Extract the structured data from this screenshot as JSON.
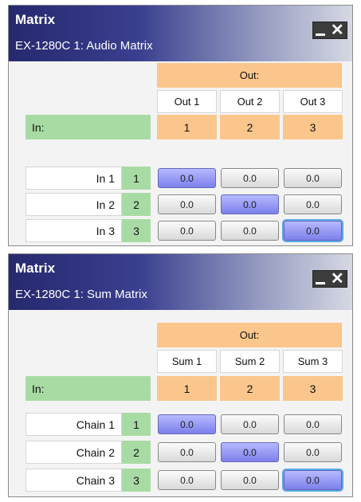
{
  "panels": [
    {
      "title": "Matrix",
      "subtitle": "EX-1280C 1: Audio Matrix",
      "out_label": "Out:",
      "in_label": "In:",
      "columns": [
        {
          "label": "Out 1",
          "num": "1"
        },
        {
          "label": "Out 2",
          "num": "2"
        },
        {
          "label": "Out 3",
          "num": "3"
        }
      ],
      "rows": [
        {
          "label": "In 1",
          "num": "1",
          "cells": [
            {
              "value": "0.0",
              "on": true
            },
            {
              "value": "0.0",
              "on": false
            },
            {
              "value": "0.0",
              "on": false
            }
          ]
        },
        {
          "label": "In 2",
          "num": "2",
          "cells": [
            {
              "value": "0.0",
              "on": false
            },
            {
              "value": "0.0",
              "on": true
            },
            {
              "value": "0.0",
              "on": false
            }
          ]
        },
        {
          "label": "In 3",
          "num": "3",
          "cells": [
            {
              "value": "0.0",
              "on": false
            },
            {
              "value": "0.0",
              "on": false
            },
            {
              "value": "0.0",
              "on": true,
              "focused": true
            }
          ]
        }
      ]
    },
    {
      "title": "Matrix",
      "subtitle": "EX-1280C 1: Sum Matrix",
      "out_label": "Out:",
      "in_label": "In:",
      "columns": [
        {
          "label": "Sum 1",
          "num": "1"
        },
        {
          "label": "Sum 2",
          "num": "2"
        },
        {
          "label": "Sum 3",
          "num": "3"
        }
      ],
      "rows": [
        {
          "label": "Chain 1",
          "num": "1",
          "cells": [
            {
              "value": "0.0",
              "on": true
            },
            {
              "value": "0.0",
              "on": false
            },
            {
              "value": "0.0",
              "on": false
            }
          ]
        },
        {
          "label": "Chain 2",
          "num": "2",
          "cells": [
            {
              "value": "0.0",
              "on": false
            },
            {
              "value": "0.0",
              "on": true
            },
            {
              "value": "0.0",
              "on": false
            }
          ]
        },
        {
          "label": "Chain 3",
          "num": "3",
          "cells": [
            {
              "value": "0.0",
              "on": false
            },
            {
              "value": "0.0",
              "on": false
            },
            {
              "value": "0.0",
              "on": true,
              "focused": true
            }
          ]
        }
      ]
    }
  ],
  "colors": {
    "header_orange": "#fbc68c",
    "input_green": "#a8dba3",
    "active_cell": "#7c80ea",
    "titlebar_dark": "#26296e"
  },
  "icons": {
    "minimize": "minimize-icon",
    "close": "close-icon"
  }
}
